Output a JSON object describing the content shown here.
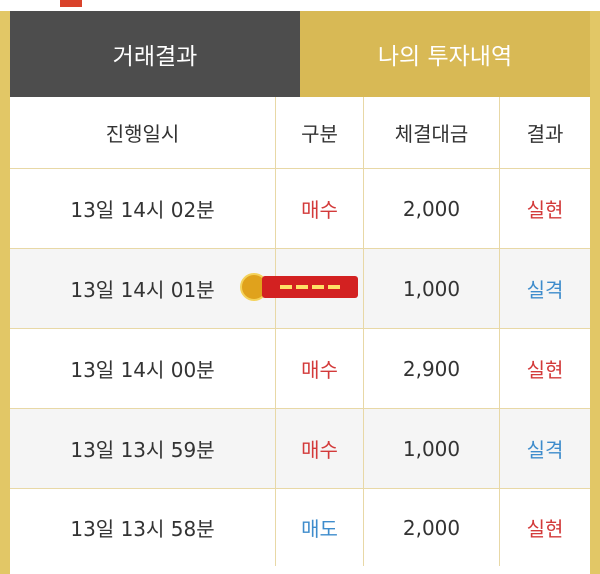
{
  "tabs": [
    {
      "label": "거래결과",
      "active": true
    },
    {
      "label": "나의 투자내역",
      "active": false
    }
  ],
  "table": {
    "headers": [
      "진행일시",
      "구분",
      "체결대금",
      "결과"
    ],
    "rows": [
      {
        "time": "13일 14시 02분",
        "type": "매수",
        "amount": "2,000",
        "result": "실현"
      },
      {
        "time": "13일 14시 01분",
        "type": "",
        "amount": "1,000",
        "result": "실격"
      },
      {
        "time": "13일 14시 00분",
        "type": "매수",
        "amount": "2,900",
        "result": "실현"
      },
      {
        "time": "13일 13시 59분",
        "type": "매수",
        "amount": "1,000",
        "result": "실격"
      },
      {
        "time": "13일 13시 58분",
        "type": "매도",
        "amount": "2,000",
        "result": "실현"
      }
    ]
  },
  "colors": {
    "frame_gold": "#e2c766",
    "active_tab": "#4d4d4d",
    "buy_red": "#d33a3a",
    "sell_blue": "#3e8ccc"
  },
  "watermark": {
    "icon": "site-logo-icon"
  }
}
